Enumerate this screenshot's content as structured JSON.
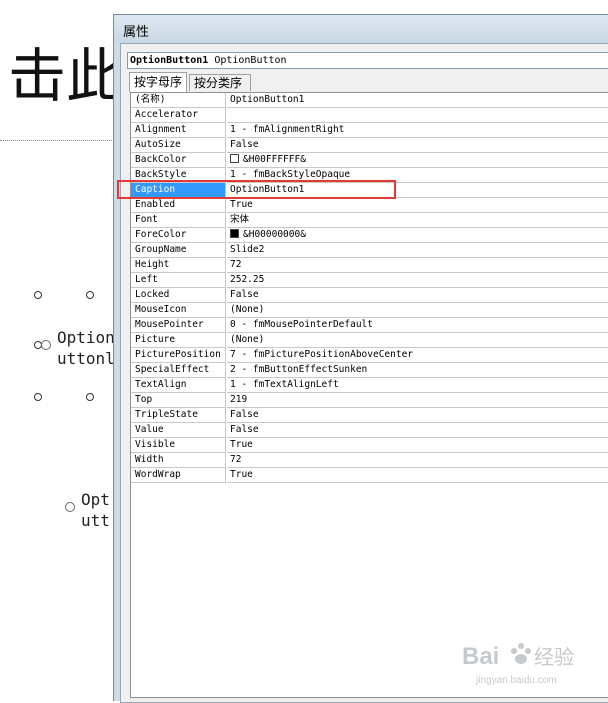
{
  "slide": {
    "title_fragment": "击此",
    "option_a_line1": "Option",
    "option_a_line2": "uttonl",
    "option_b_line1": "Opt",
    "option_b_line2": "utt"
  },
  "window": {
    "title": "属性",
    "object_name": "OptionButton1",
    "object_type": "OptionButton",
    "tabs": [
      "按字母序",
      "按分类序"
    ]
  },
  "properties": [
    {
      "name": "(名称)",
      "value": "OptionButton1"
    },
    {
      "name": "Accelerator",
      "value": ""
    },
    {
      "name": "Alignment",
      "value": "1 - fmAlignmentRight"
    },
    {
      "name": "AutoSize",
      "value": "False"
    },
    {
      "name": "BackColor",
      "value": "&H00FFFFFF&",
      "swatch": "#ffffff"
    },
    {
      "name": "BackStyle",
      "value": "1 - fmBackStyleOpaque"
    },
    {
      "name": "Caption",
      "value": "OptionButton1",
      "selected": true
    },
    {
      "name": "Enabled",
      "value": "True"
    },
    {
      "name": "Font",
      "value": "宋体"
    },
    {
      "name": "ForeColor",
      "value": "&H00000000&",
      "swatch": "#000000"
    },
    {
      "name": "GroupName",
      "value": "Slide2"
    },
    {
      "name": "Height",
      "value": "72"
    },
    {
      "name": "Left",
      "value": "252.25"
    },
    {
      "name": "Locked",
      "value": "False"
    },
    {
      "name": "MouseIcon",
      "value": "(None)"
    },
    {
      "name": "MousePointer",
      "value": "0 - fmMousePointerDefault"
    },
    {
      "name": "Picture",
      "value": "(None)"
    },
    {
      "name": "PicturePosition",
      "value": "7 - fmPicturePositionAboveCenter"
    },
    {
      "name": "SpecialEffect",
      "value": "2 - fmButtonEffectSunken"
    },
    {
      "name": "TextAlign",
      "value": "1 - fmTextAlignLeft"
    },
    {
      "name": "Top",
      "value": "219"
    },
    {
      "name": "TripleState",
      "value": "False"
    },
    {
      "name": "Value",
      "value": "False"
    },
    {
      "name": "Visible",
      "value": "True"
    },
    {
      "name": "Width",
      "value": "72"
    },
    {
      "name": "WordWrap",
      "value": "True"
    }
  ],
  "colors": {
    "selection": "#3399ff",
    "highlight_box": "#e53935"
  },
  "watermark": {
    "brand": "Bai",
    "brand_tail": "经验",
    "url": "jingyan.baidu.com"
  }
}
